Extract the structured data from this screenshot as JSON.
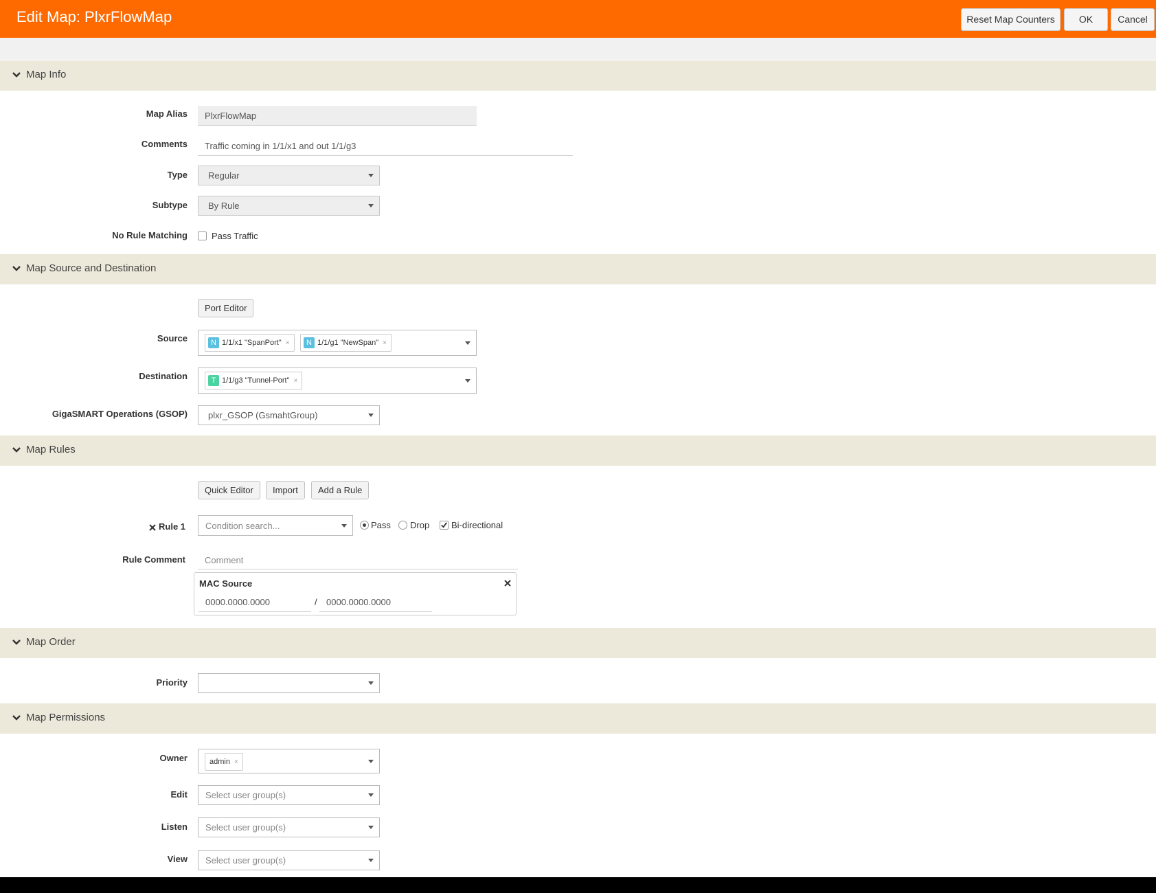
{
  "header": {
    "title": "Edit Map: PlxrFlowMap",
    "reset_label": "Reset Map Counters",
    "ok_label": "OK",
    "cancel_label": "Cancel"
  },
  "map_info": {
    "title": "Map Info",
    "alias_label": "Map Alias",
    "alias_value": "PlxrFlowMap",
    "comments_label": "Comments",
    "comments_value": "Traffic coming in 1/1/x1 and out 1/1/g3",
    "type_label": "Type",
    "type_value": "Regular",
    "subtype_label": "Subtype",
    "subtype_value": "By Rule",
    "no_rule_label": "No Rule Matching",
    "pass_traffic_label": "Pass Traffic",
    "pass_traffic_checked": false
  },
  "source_dest": {
    "title": "Map Source and Destination",
    "port_editor_label": "Port Editor",
    "source_label": "Source",
    "source_tags": [
      {
        "badge": "N",
        "text": "1/1/x1 \"SpanPort\"",
        "color": "#5bc0de"
      },
      {
        "badge": "N",
        "text": "1/1/g1 \"NewSpan\"",
        "color": "#5bc0de"
      }
    ],
    "destination_label": "Destination",
    "destination_tags": [
      {
        "badge": "T",
        "text": "1/1/g3 \"Tunnel-Port\"",
        "color": "#4cd3a1"
      }
    ],
    "gsop_label": "GigaSMART Operations (GSOP)",
    "gsop_value": "plxr_GSOP (GsmahtGroup)"
  },
  "rules": {
    "title": "Map Rules",
    "quick_editor_label": "Quick Editor",
    "import_label": "Import",
    "add_rule_label": "Add a Rule",
    "rule_label": "Rule 1",
    "condition_placeholder": "Condition search...",
    "pass_label": "Pass",
    "drop_label": "Drop",
    "bidir_label": "Bi-directional",
    "rule_comment_label": "Rule Comment",
    "comment_placeholder": "Comment",
    "mac_title": "MAC Source",
    "mac_value": "0000.0000.0000",
    "mac_mask": "0000.0000.0000",
    "slash": "/"
  },
  "order": {
    "title": "Map Order",
    "priority_label": "Priority"
  },
  "permissions": {
    "title": "Map Permissions",
    "owner_label": "Owner",
    "owner_tag": "admin",
    "edit_label": "Edit",
    "listen_label": "Listen",
    "view_label": "View",
    "group_placeholder": "Select user group(s)"
  },
  "colors": {
    "header": "#ff6a00",
    "section": "#ece8da"
  }
}
